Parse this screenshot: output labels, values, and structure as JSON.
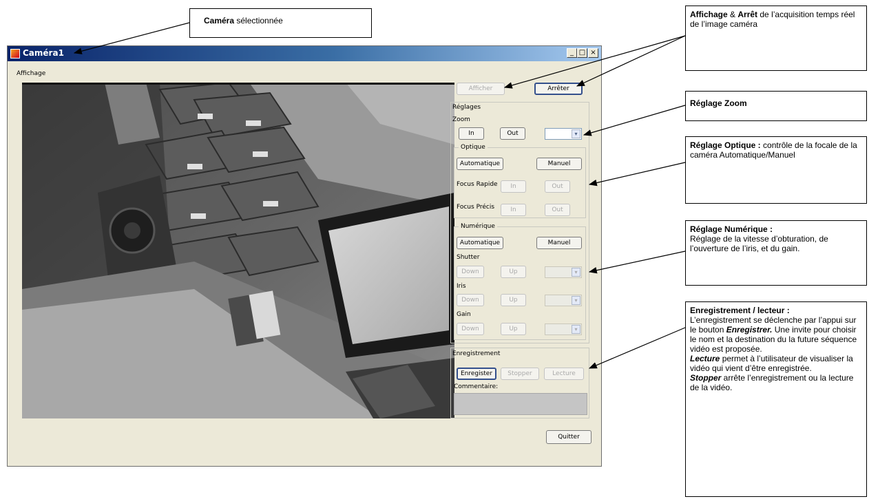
{
  "callouts": {
    "camera": {
      "bold": "Caméra",
      "rest": " sélectionnée"
    },
    "display": {
      "bold1": "Affichage",
      "amp": " & ",
      "bold2": "Arrêt",
      "rest": " de l’acquisition temps réel de l’image caméra"
    },
    "zoom": {
      "bold": "Réglage Zoom"
    },
    "optics": {
      "bold": "Réglage Optique :",
      "rest": " contrôle de la focale de la caméra Automatique/Manuel"
    },
    "numeric": {
      "bold": "Réglage Numérique :",
      "rest": "Réglage de la vitesse d’obturation, de l’ouverture de l’iris, et du gain."
    },
    "recording": {
      "title": "Enregistrement / lecteur :",
      "line1": "L’enregistrement se déclenche par l’appui sur le bouton ",
      "enregistrer": "Enregistrer.",
      "line2": " Une invite pour choisir le nom et la destination du la future séquence vidéo est proposée.",
      "lecture": "Lecture",
      "line3": " permet à l’utilisateur de visualiser la vidéo qui vient d’être enregistrée.",
      "stopper": "Stopper",
      "line4": " arrête l’enregistrement ou la lecture de la vidéo."
    }
  },
  "window": {
    "title": "Caméra1",
    "minimize": "_",
    "maximize": "□",
    "close": "×",
    "display_group": "Affichage",
    "buttons": {
      "afficher": "Afficher",
      "arreter": "Arrêter",
      "quitter": "Quitter"
    },
    "reglages": {
      "title": "Réglages",
      "zoom_label": "Zoom",
      "zoom_in": "In",
      "zoom_out": "Out",
      "optique": {
        "title": "Optique",
        "auto": "Automatique",
        "manuel": "Manuel",
        "focus_rapide": "Focus Rapide",
        "focus_precis": "Focus Précis",
        "in": "In",
        "out": "Out"
      },
      "numerique": {
        "title": "Numérique",
        "auto": "Automatique",
        "manuel": "Manuel",
        "shutter": "Shutter",
        "iris": "Iris",
        "gain": "Gain",
        "down": "Down",
        "up": "Up"
      }
    },
    "enregistrement": {
      "title": "Enregistrement",
      "enregistrer": "Enregister",
      "stopper": "Stopper",
      "lecture": "Lecture",
      "commentaire": "Commentaire:"
    }
  },
  "colors": {
    "title_start": "#0a246a",
    "title_end": "#a6caf0",
    "window_bg": "#ece9d8"
  },
  "icons": {
    "combo_arrow": "chevron-down-icon",
    "arrow": "callout-arrow"
  }
}
